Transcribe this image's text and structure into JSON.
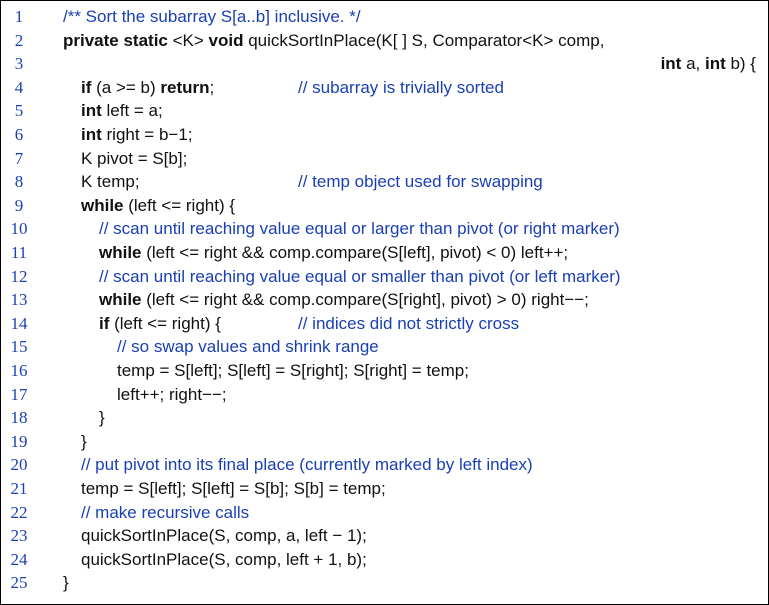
{
  "lines": [
    {
      "num": "1",
      "indent": 0,
      "parts": [
        {
          "t": "/** Sort the subarray S[a..b] inclusive. */",
          "c": "cmt"
        }
      ]
    },
    {
      "num": "2",
      "indent": 0,
      "parts": [
        {
          "t": "private static",
          "c": "kw"
        },
        {
          "t": " <K> ",
          "c": ""
        },
        {
          "t": "void",
          "c": "kw"
        },
        {
          "t": " quickSortInPlace(K[ ] S, Comparator<K> comp,",
          "c": ""
        }
      ]
    },
    {
      "num": "3",
      "indent": 0,
      "right": [
        {
          "t": "int",
          "c": "kw"
        },
        {
          "t": " a, ",
          "c": ""
        },
        {
          "t": "int",
          "c": "kw"
        },
        {
          "t": " b) {",
          "c": ""
        }
      ]
    },
    {
      "num": "4",
      "indent": 1,
      "parts": [
        {
          "t": "if",
          "c": "kw"
        },
        {
          "t": " (a >= b) ",
          "c": ""
        },
        {
          "t": "return",
          "c": "kw"
        },
        {
          "t": ";",
          "c": ""
        }
      ],
      "comment": "// subarray is trivially sorted"
    },
    {
      "num": "5",
      "indent": 1,
      "parts": [
        {
          "t": "int",
          "c": "kw"
        },
        {
          "t": " left = a;",
          "c": ""
        }
      ]
    },
    {
      "num": "6",
      "indent": 1,
      "parts": [
        {
          "t": "int",
          "c": "kw"
        },
        {
          "t": " right = b−1;",
          "c": ""
        }
      ]
    },
    {
      "num": "7",
      "indent": 1,
      "parts": [
        {
          "t": "K pivot = S[b];",
          "c": ""
        }
      ]
    },
    {
      "num": "8",
      "indent": 1,
      "parts": [
        {
          "t": "K temp;",
          "c": ""
        }
      ],
      "comment": "// temp object used for swapping"
    },
    {
      "num": "9",
      "indent": 1,
      "parts": [
        {
          "t": "while",
          "c": "kw"
        },
        {
          "t": " (left <= right) {",
          "c": ""
        }
      ]
    },
    {
      "num": "10",
      "indent": 2,
      "parts": [
        {
          "t": "// scan until reaching value equal or larger than pivot (or right marker)",
          "c": "cmt"
        }
      ]
    },
    {
      "num": "11",
      "indent": 2,
      "parts": [
        {
          "t": "while",
          "c": "kw"
        },
        {
          "t": " (left <= right && comp.compare(S[left], pivot) < 0) left++;",
          "c": ""
        }
      ]
    },
    {
      "num": "12",
      "indent": 2,
      "parts": [
        {
          "t": "// scan until reaching value equal or smaller than pivot (or left marker)",
          "c": "cmt"
        }
      ]
    },
    {
      "num": "13",
      "indent": 2,
      "parts": [
        {
          "t": "while",
          "c": "kw"
        },
        {
          "t": " (left <= right && comp.compare(S[right], pivot) > 0) right−−;",
          "c": ""
        }
      ]
    },
    {
      "num": "14",
      "indent": 2,
      "parts": [
        {
          "t": "if",
          "c": "kw"
        },
        {
          "t": " (left <= right) {",
          "c": ""
        }
      ],
      "comment": "// indices did not strictly cross"
    },
    {
      "num": "15",
      "indent": 3,
      "parts": [
        {
          "t": "// so swap values and shrink range",
          "c": "cmt"
        }
      ]
    },
    {
      "num": "16",
      "indent": 3,
      "parts": [
        {
          "t": "temp = S[left]; S[left] = S[right]; S[right] = temp;",
          "c": ""
        }
      ]
    },
    {
      "num": "17",
      "indent": 3,
      "parts": [
        {
          "t": "left++; right−−;",
          "c": ""
        }
      ]
    },
    {
      "num": "18",
      "indent": 2,
      "parts": [
        {
          "t": "}",
          "c": ""
        }
      ]
    },
    {
      "num": "19",
      "indent": 1,
      "parts": [
        {
          "t": "}",
          "c": ""
        }
      ]
    },
    {
      "num": "20",
      "indent": 1,
      "parts": [
        {
          "t": "// put pivot into its final place (currently marked by left index)",
          "c": "cmt"
        }
      ]
    },
    {
      "num": "21",
      "indent": 1,
      "parts": [
        {
          "t": "temp = S[left]; S[left] = S[b]; S[b] = temp;",
          "c": ""
        }
      ]
    },
    {
      "num": "22",
      "indent": 1,
      "parts": [
        {
          "t": "// make recursive calls",
          "c": "cmt"
        }
      ]
    },
    {
      "num": "23",
      "indent": 1,
      "parts": [
        {
          "t": "quickSortInPlace(S, comp, a, left − 1);",
          "c": ""
        }
      ]
    },
    {
      "num": "24",
      "indent": 1,
      "parts": [
        {
          "t": "quickSortInPlace(S, comp, left + 1, b);",
          "c": ""
        }
      ]
    },
    {
      "num": "25",
      "indent": 0,
      "parts": [
        {
          "t": "}",
          "c": ""
        }
      ]
    }
  ],
  "colors": {
    "comment": "#1a3fb5",
    "line_number": "#1a3fb5",
    "code": "#111111"
  }
}
